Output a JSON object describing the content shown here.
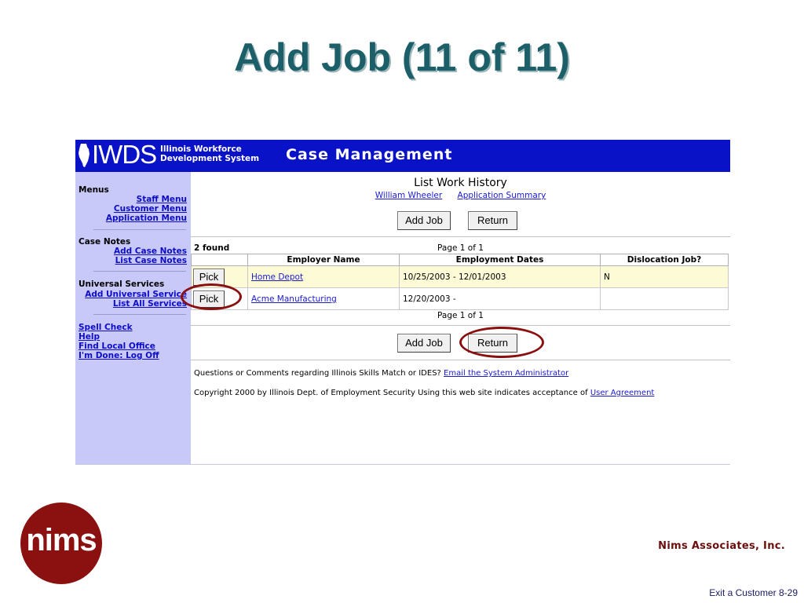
{
  "slide": {
    "title": "Add Job (11 of 11)",
    "company": "Nims Associates, Inc.",
    "logo_text": "nims",
    "footer": "Exit a Customer 8-29"
  },
  "banner": {
    "logo_text": "IWDS",
    "org_line1": "Illinois Workforce",
    "org_line2": "Development System",
    "app_title": "Case Management",
    "bg_color": "#0a12c8"
  },
  "sidebar": {
    "menus_head": "Menus",
    "menus": [
      "Staff Menu",
      "Customer Menu",
      "Application Menu"
    ],
    "case_notes_head": "Case Notes",
    "case_notes": [
      "Add Case Notes",
      "List Case Notes"
    ],
    "universal_head": "Universal Services",
    "universal": [
      "Add Universal Service",
      "List All Services"
    ],
    "misc": [
      "Spell Check",
      "Help",
      "Find Local Office",
      "I'm Done: Log Off"
    ]
  },
  "main": {
    "heading": "List Work History",
    "customer_link": "William Wheeler",
    "summary_link": "Application Summary",
    "add_job_label": "Add Job",
    "return_label": "Return",
    "found_text": "2 found",
    "page_info": "Page 1 of 1",
    "columns": [
      "",
      "Employer Name",
      "Employment Dates",
      "Dislocation Job?"
    ],
    "rows": [
      {
        "pick": "Pick",
        "employer": "Home Depot",
        "dates": "10/25/2003 - 12/01/2003",
        "dislocation": "N"
      },
      {
        "pick": "Pick",
        "employer": "Acme Manufacturing",
        "dates": "12/20/2003 -",
        "dislocation": ""
      }
    ]
  },
  "footer": {
    "questions_text": "Questions or Comments regarding Illinois Skills Match or IDES?",
    "email_link": "Email the System Administrator",
    "copyright_text": "Copyright 2000 by Illinois Dept. of Employment Security Using this web site indicates acceptance of",
    "agreement_link": "User Agreement"
  },
  "annotation_color": "#8a1010"
}
